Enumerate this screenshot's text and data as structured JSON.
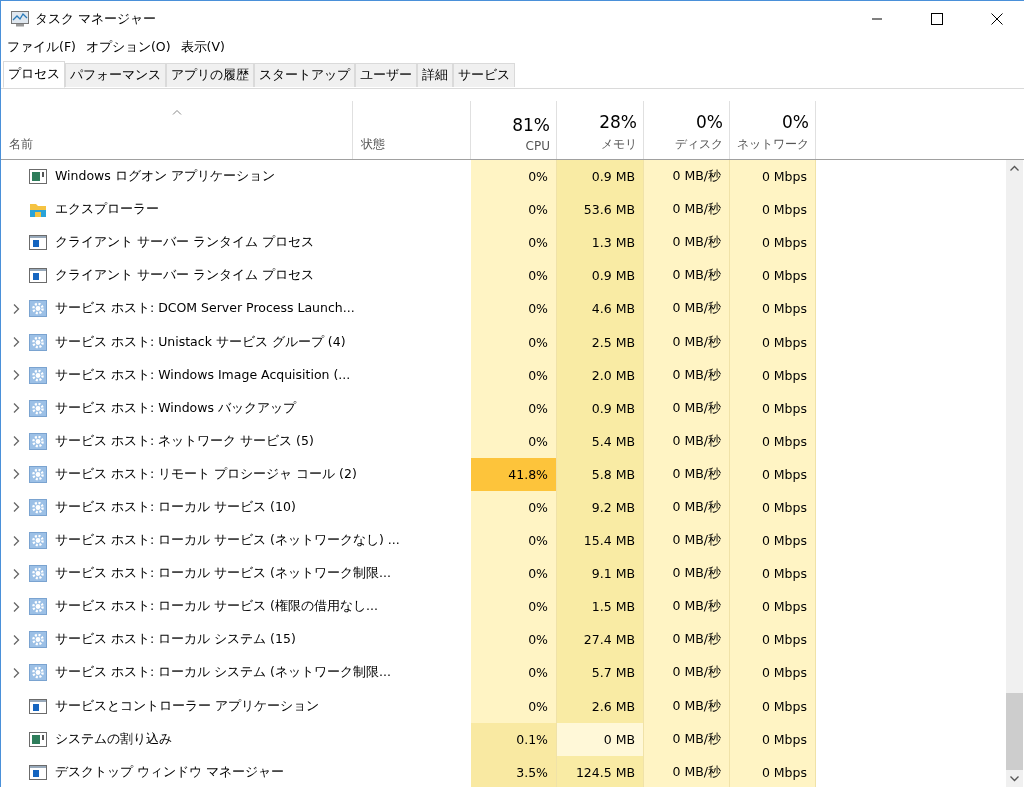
{
  "window": {
    "title": "タスク マネージャー"
  },
  "menu": [
    "ファイル(F)",
    "オプション(O)",
    "表示(V)"
  ],
  "tabs": [
    {
      "label": "プロセス",
      "selected": true
    },
    {
      "label": "パフォーマンス",
      "selected": false
    },
    {
      "label": "アプリの履歴",
      "selected": false
    },
    {
      "label": "スタートアップ",
      "selected": false
    },
    {
      "label": "ユーザー",
      "selected": false
    },
    {
      "label": "詳細",
      "selected": false
    },
    {
      "label": "サービス",
      "selected": false
    }
  ],
  "columns": [
    {
      "label": "名前",
      "sorted": true
    },
    {
      "label": "状態",
      "sorted": false
    },
    {
      "label": "CPU",
      "total": "81%",
      "sorted": false
    },
    {
      "label": "メモリ",
      "total": "28%",
      "sorted": false
    },
    {
      "label": "ディスク",
      "total": "0%",
      "sorted": false
    },
    {
      "label": "ネットワーク",
      "total": "0%",
      "sorted": false
    }
  ],
  "rows": [
    {
      "name": "Windows ログオン アプリケーション",
      "kind": "system",
      "expandable": false,
      "cells": [
        {
          "text": "0%",
          "color": "#fff4c4"
        },
        {
          "text": "0.9 MB",
          "color": "#f9eba4"
        },
        {
          "text": "0 MB/秒",
          "color": "#fff4c4"
        },
        {
          "text": "0 Mbps",
          "color": "#fff4c4"
        }
      ]
    },
    {
      "name": "エクスプローラー",
      "kind": "app",
      "expandable": false,
      "cells": [
        {
          "text": "0%",
          "color": "#fff4c4"
        },
        {
          "text": "53.6 MB",
          "color": "#f9eba4"
        },
        {
          "text": "0 MB/秒",
          "color": "#fff4c4"
        },
        {
          "text": "0 Mbps",
          "color": "#fff4c4"
        }
      ]
    },
    {
      "name": "クライアント サーバー ランタイム プロセス",
      "kind": "process",
      "expandable": false,
      "cells": [
        {
          "text": "0%",
          "color": "#fff4c4"
        },
        {
          "text": "1.3 MB",
          "color": "#f9eba4"
        },
        {
          "text": "0 MB/秒",
          "color": "#fff4c4"
        },
        {
          "text": "0 Mbps",
          "color": "#fff4c4"
        }
      ]
    },
    {
      "name": "クライアント サーバー ランタイム プロセス",
      "kind": "process",
      "expandable": false,
      "cells": [
        {
          "text": "0%",
          "color": "#fff4c4"
        },
        {
          "text": "0.9 MB",
          "color": "#f9eba4"
        },
        {
          "text": "0 MB/秒",
          "color": "#fff4c4"
        },
        {
          "text": "0 Mbps",
          "color": "#fff4c4"
        }
      ]
    },
    {
      "name": "サービス ホスト: DCOM Server Process Launch...",
      "kind": "service",
      "expandable": true,
      "cells": [
        {
          "text": "0%",
          "color": "#fff4c4"
        },
        {
          "text": "4.6 MB",
          "color": "#f9eba4"
        },
        {
          "text": "0 MB/秒",
          "color": "#fff4c4"
        },
        {
          "text": "0 Mbps",
          "color": "#fff4c4"
        }
      ]
    },
    {
      "name": "サービス ホスト: Unistack サービス グループ (4)",
      "kind": "service",
      "expandable": true,
      "cells": [
        {
          "text": "0%",
          "color": "#fff4c4"
        },
        {
          "text": "2.5 MB",
          "color": "#f9eba4"
        },
        {
          "text": "0 MB/秒",
          "color": "#fff4c4"
        },
        {
          "text": "0 Mbps",
          "color": "#fff4c4"
        }
      ]
    },
    {
      "name": "サービス ホスト: Windows Image Acquisition (...",
      "kind": "service",
      "expandable": true,
      "cells": [
        {
          "text": "0%",
          "color": "#fff4c4"
        },
        {
          "text": "2.0 MB",
          "color": "#f9eba4"
        },
        {
          "text": "0 MB/秒",
          "color": "#fff4c4"
        },
        {
          "text": "0 Mbps",
          "color": "#fff4c4"
        }
      ]
    },
    {
      "name": "サービス ホスト: Windows バックアップ",
      "kind": "service",
      "expandable": true,
      "cells": [
        {
          "text": "0%",
          "color": "#fff4c4"
        },
        {
          "text": "0.9 MB",
          "color": "#f9eba4"
        },
        {
          "text": "0 MB/秒",
          "color": "#fff4c4"
        },
        {
          "text": "0 Mbps",
          "color": "#fff4c4"
        }
      ]
    },
    {
      "name": "サービス ホスト: ネットワーク サービス (5)",
      "kind": "service",
      "expandable": true,
      "cells": [
        {
          "text": "0%",
          "color": "#fff4c4"
        },
        {
          "text": "5.4 MB",
          "color": "#f9eba4"
        },
        {
          "text": "0 MB/秒",
          "color": "#fff4c4"
        },
        {
          "text": "0 Mbps",
          "color": "#fff4c4"
        }
      ]
    },
    {
      "name": "サービス ホスト: リモート プロシージャ コール (2)",
      "kind": "service",
      "expandable": true,
      "cells": [
        {
          "text": "41.8%",
          "color": "#fdc43b"
        },
        {
          "text": "5.8 MB",
          "color": "#f9eba4"
        },
        {
          "text": "0 MB/秒",
          "color": "#fff4c4"
        },
        {
          "text": "0 Mbps",
          "color": "#fff4c4"
        }
      ]
    },
    {
      "name": "サービス ホスト: ローカル サービス (10)",
      "kind": "service",
      "expandable": true,
      "cells": [
        {
          "text": "0%",
          "color": "#fff4c4"
        },
        {
          "text": "9.2 MB",
          "color": "#f9eba4"
        },
        {
          "text": "0 MB/秒",
          "color": "#fff4c4"
        },
        {
          "text": "0 Mbps",
          "color": "#fff4c4"
        }
      ]
    },
    {
      "name": "サービス ホスト: ローカル サービス (ネットワークなし) ...",
      "kind": "service",
      "expandable": true,
      "cells": [
        {
          "text": "0%",
          "color": "#fff4c4"
        },
        {
          "text": "15.4 MB",
          "color": "#f9eba4"
        },
        {
          "text": "0 MB/秒",
          "color": "#fff4c4"
        },
        {
          "text": "0 Mbps",
          "color": "#fff4c4"
        }
      ]
    },
    {
      "name": "サービス ホスト: ローカル サービス (ネットワーク制限...",
      "kind": "service",
      "expandable": true,
      "cells": [
        {
          "text": "0%",
          "color": "#fff4c4"
        },
        {
          "text": "9.1 MB",
          "color": "#f9eba4"
        },
        {
          "text": "0 MB/秒",
          "color": "#fff4c4"
        },
        {
          "text": "0 Mbps",
          "color": "#fff4c4"
        }
      ]
    },
    {
      "name": "サービス ホスト: ローカル サービス (権限の借用なし...",
      "kind": "service",
      "expandable": true,
      "cells": [
        {
          "text": "0%",
          "color": "#fff4c4"
        },
        {
          "text": "1.5 MB",
          "color": "#f9eba4"
        },
        {
          "text": "0 MB/秒",
          "color": "#fff4c4"
        },
        {
          "text": "0 Mbps",
          "color": "#fff4c4"
        }
      ]
    },
    {
      "name": "サービス ホスト: ローカル システム (15)",
      "kind": "service",
      "expandable": true,
      "cells": [
        {
          "text": "0%",
          "color": "#fff4c4"
        },
        {
          "text": "27.4 MB",
          "color": "#f9eba4"
        },
        {
          "text": "0 MB/秒",
          "color": "#fff4c4"
        },
        {
          "text": "0 Mbps",
          "color": "#fff4c4"
        }
      ]
    },
    {
      "name": "サービス ホスト: ローカル システム (ネットワーク制限...",
      "kind": "service",
      "expandable": true,
      "cells": [
        {
          "text": "0%",
          "color": "#fff4c4"
        },
        {
          "text": "5.7 MB",
          "color": "#f9eba4"
        },
        {
          "text": "0 MB/秒",
          "color": "#fff4c4"
        },
        {
          "text": "0 Mbps",
          "color": "#fff4c4"
        }
      ]
    },
    {
      "name": "サービスとコントローラー アプリケーション",
      "kind": "process",
      "expandable": false,
      "cells": [
        {
          "text": "0%",
          "color": "#fff4c4"
        },
        {
          "text": "2.6 MB",
          "color": "#f9eba4"
        },
        {
          "text": "0 MB/秒",
          "color": "#fff4c4"
        },
        {
          "text": "0 Mbps",
          "color": "#fff4c4"
        }
      ]
    },
    {
      "name": "システムの割り込み",
      "kind": "system",
      "expandable": false,
      "cells": [
        {
          "text": "0.1%",
          "color": "#f9e9a2"
        },
        {
          "text": "0 MB",
          "color": "#fff8d8"
        },
        {
          "text": "0 MB/秒",
          "color": "#fff4c4"
        },
        {
          "text": "0 Mbps",
          "color": "#fff4c4"
        }
      ]
    },
    {
      "name": "デスクトップ ウィンドウ マネージャー",
      "kind": "process",
      "expandable": false,
      "cells": [
        {
          "text": "3.5%",
          "color": "#f9e9a2"
        },
        {
          "text": "124.5 MB",
          "color": "#f9eba4"
        },
        {
          "text": "0 MB/秒",
          "color": "#fff4c4"
        },
        {
          "text": "0 Mbps",
          "color": "#fff4c4"
        }
      ]
    }
  ]
}
